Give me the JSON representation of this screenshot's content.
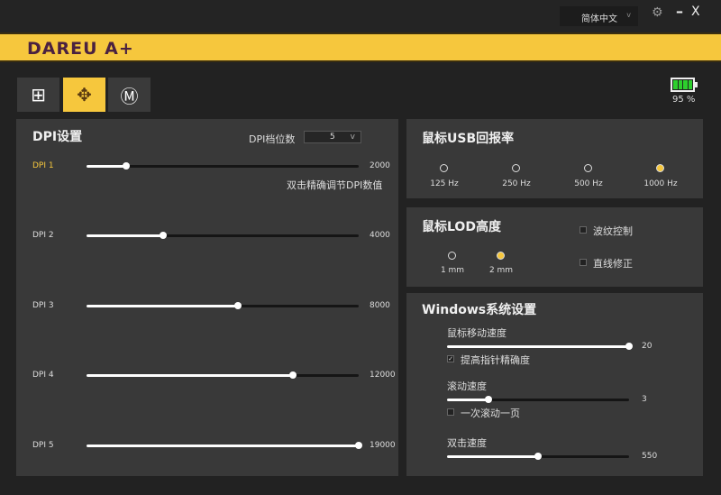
{
  "titlebar": {
    "language": "简体中文",
    "min": "–",
    "close": "X"
  },
  "brand": {
    "logo": "DAREU A+"
  },
  "toolbar": [
    {
      "name": "custom-keys",
      "glyph": "⊞"
    },
    {
      "name": "dpi",
      "glyph": "✥"
    },
    {
      "name": "macro",
      "glyph": "Ⓜ"
    }
  ],
  "battery": {
    "percent_label": "95 %",
    "level": 0.95
  },
  "dpi": {
    "title": "DPI设置",
    "levels_label": "DPI档位数",
    "levels_value": "5",
    "hint": "双击精确调节DPI数值",
    "rows": [
      {
        "label": "DPI 1",
        "value": "2000",
        "fill": 0.146,
        "active": true
      },
      {
        "label": "DPI 2",
        "value": "4000",
        "fill": 0.281
      },
      {
        "label": "DPI 3",
        "value": "8000",
        "fill": 0.556
      },
      {
        "label": "DPI 4",
        "value": "12000",
        "fill": 0.758
      },
      {
        "label": "DPI 5",
        "value": "19000",
        "fill": 1.0
      }
    ]
  },
  "usb": {
    "title": "鼠标USB回报率",
    "options": [
      "125 Hz",
      "250 Hz",
      "500 Hz",
      "1000 Hz"
    ],
    "selected": 3
  },
  "lod": {
    "title": "鼠标LOD高度",
    "options": [
      "1 mm",
      "2 mm"
    ],
    "selected": 1,
    "ripple": "波纹控制",
    "angle": "直线修正"
  },
  "windows": {
    "title": "Windows系统设置",
    "speed_label": "鼠标移动速度",
    "speed_value": "20",
    "speed_fill": 1.0,
    "precision": "提高指针精确度",
    "scroll_label": "滚动速度",
    "scroll_value": "3",
    "scroll_fill": 0.23,
    "page": "一次滚动一页",
    "dbl_label": "双击速度",
    "dbl_value": "550",
    "dbl_fill": 0.5
  },
  "colors": {
    "accent": "#f6c73d",
    "panel": "#393939"
  }
}
